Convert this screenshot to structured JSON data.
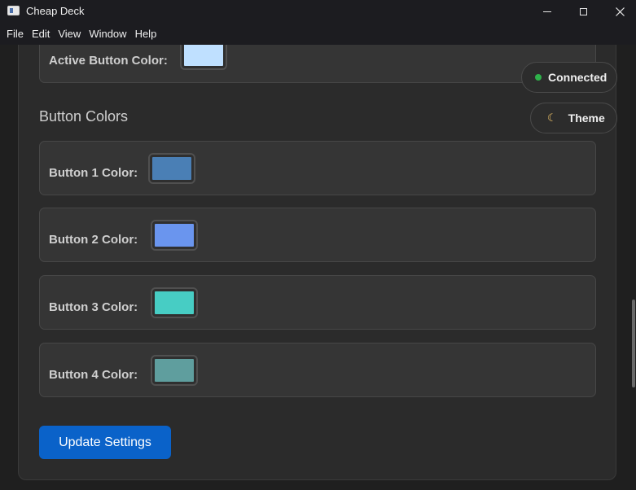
{
  "window": {
    "title": "Cheap Deck"
  },
  "menu": [
    "File",
    "Edit",
    "View",
    "Window",
    "Help"
  ],
  "active": {
    "label": "Active Button Color:",
    "color": "#bfe0ff"
  },
  "section": {
    "title": "Button Colors"
  },
  "buttons": [
    {
      "label": "Button 1 Color:",
      "color": "#4a7fb5"
    },
    {
      "label": "Button 2 Color:",
      "color": "#6a95ee"
    },
    {
      "label": "Button 3 Color:",
      "color": "#47cdc4"
    },
    {
      "label": "Button 4 Color:",
      "color": "#5f9e9e"
    }
  ],
  "status": {
    "label": "Connected",
    "dot_color": "#2eb24a"
  },
  "theme": {
    "label": "Theme",
    "icon": "moon-icon"
  },
  "actions": {
    "update_label": "Update Settings"
  }
}
